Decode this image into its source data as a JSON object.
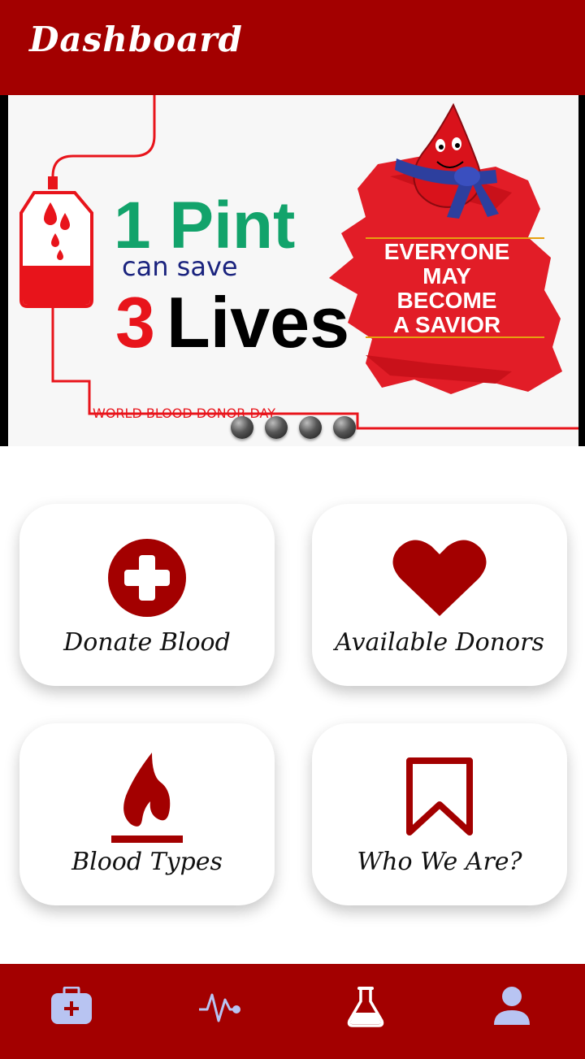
{
  "appbar": {
    "title": "Dashboard"
  },
  "banner": {
    "line1": "1 Pint",
    "line2": "can save",
    "line3_num": "3",
    "line3_word": "Lives",
    "savior_lines": [
      "EVERYONE",
      "MAY",
      "BECOME",
      "A SAVIOR"
    ],
    "event": "WORLD BLOOD DONOR DAY",
    "slide_count": 4
  },
  "cards": [
    {
      "label": "Donate Blood",
      "icon": "plus-circle-icon"
    },
    {
      "label": "Available Donors",
      "icon": "heart-icon"
    },
    {
      "label": "Blood Types",
      "icon": "flame-icon"
    },
    {
      "label": "Who We Are?",
      "icon": "bookmark-icon"
    }
  ],
  "nav": {
    "items": [
      {
        "name": "medical-kit-icon",
        "active": true
      },
      {
        "name": "pulse-icon",
        "active": false
      },
      {
        "name": "flask-icon",
        "active": false
      },
      {
        "name": "person-icon",
        "active": false
      }
    ]
  },
  "colors": {
    "primary": "#a30000",
    "green": "#12a36b",
    "navy": "#1a237e",
    "red": "#e8141b",
    "nav_active": "#b8c4f2"
  }
}
